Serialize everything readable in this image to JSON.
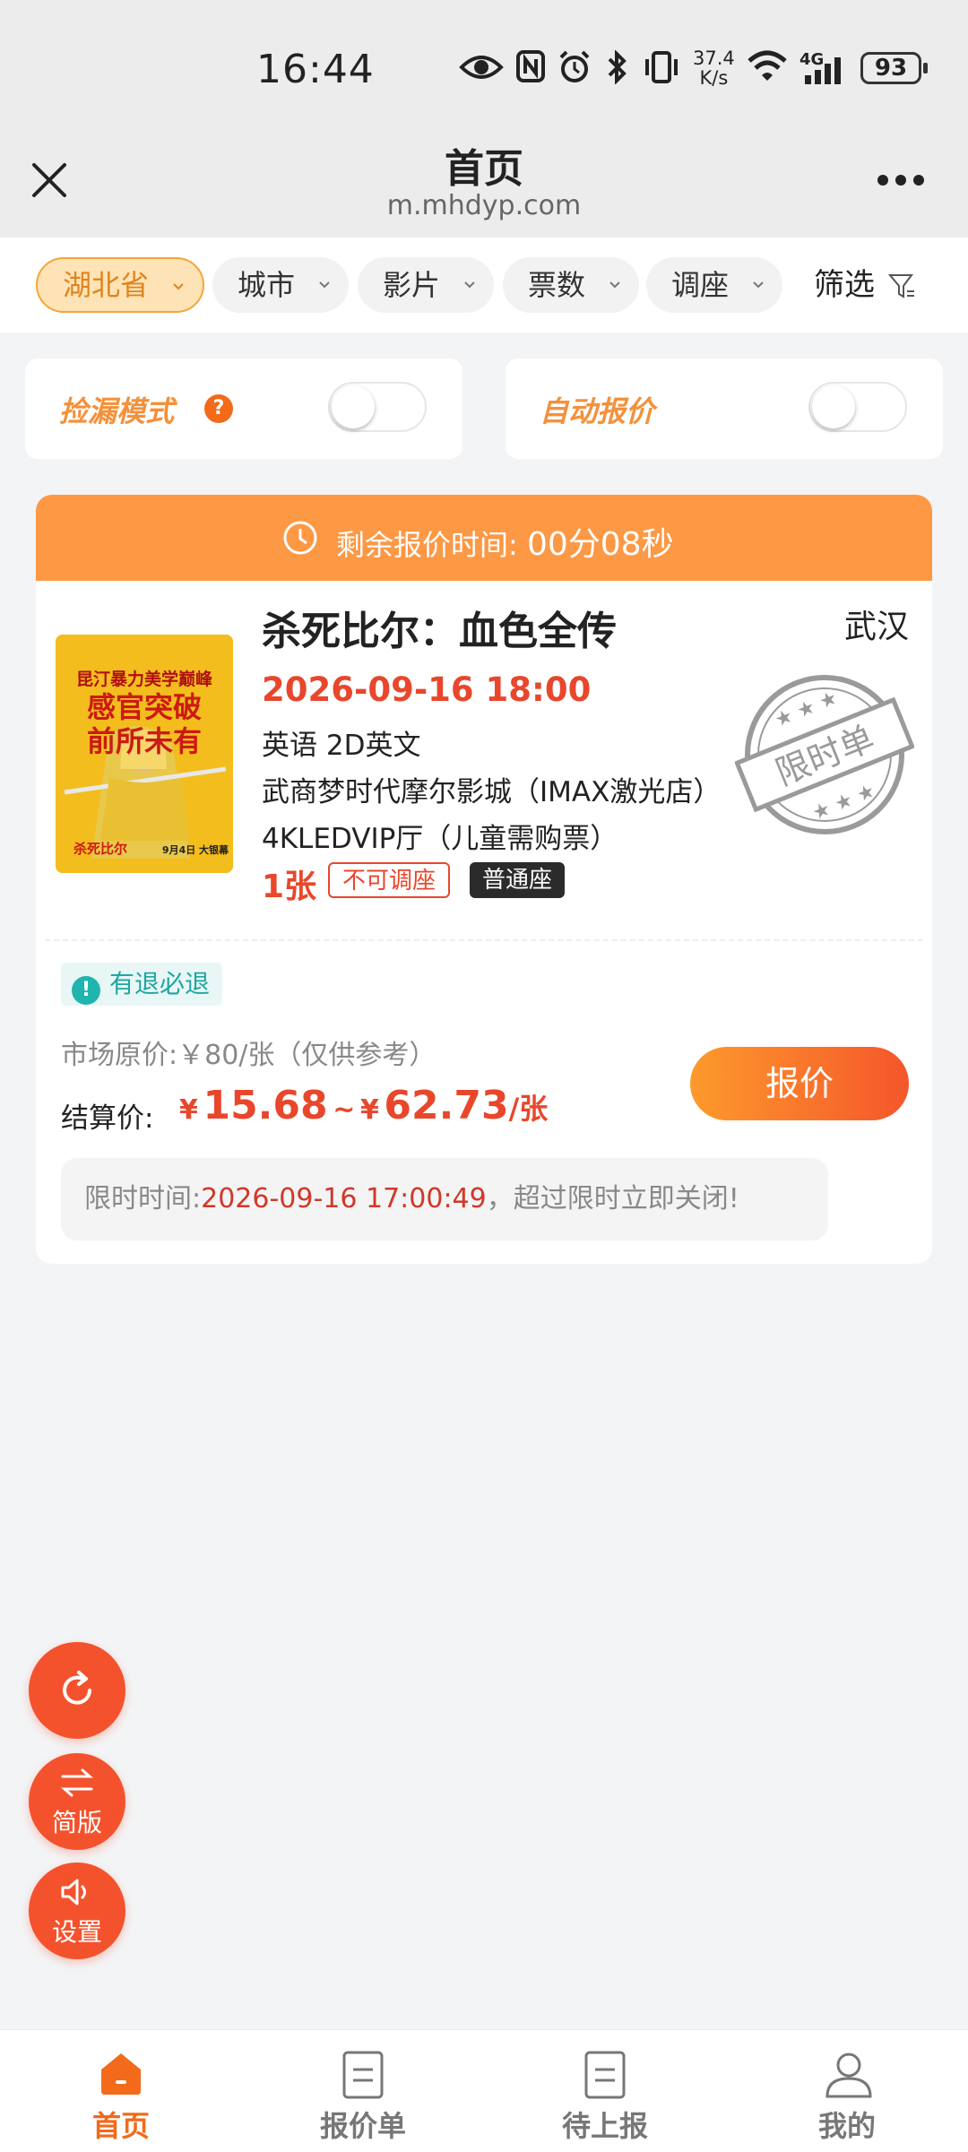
{
  "status_bar": {
    "time": "16:44",
    "net_speed_value": "37.4",
    "net_speed_unit": "K/s",
    "network_type": "4G",
    "battery": "93"
  },
  "titlebar": {
    "title": "首页",
    "url": "m.mhdyp.com"
  },
  "filters": {
    "chips": [
      "湖北省",
      "城市",
      "影片",
      "票数",
      "调座"
    ],
    "active_chip": "湖北省",
    "filter_label": "筛选"
  },
  "toggles": {
    "pickup_mode": "捡漏模式",
    "pickup_help": "?",
    "auto_quote": "自动报价"
  },
  "order": {
    "timer_label": "剩余报价时间:",
    "timer_value": "00分08秒",
    "poster_text_top": "昆汀暴力美学巅峰",
    "poster_text_main1": "感官突破",
    "poster_text_main2": "前所未有",
    "poster_text_title": "杀死比尔",
    "poster_text_date": "9月4日 大银幕",
    "movie_title": "杀死比尔：血色全传",
    "city": "武汉",
    "showtime": "2026-09-16 18:00",
    "language": "英语 2D英文",
    "cinema": "武商梦时代摩尔影城（IMAX激光店）",
    "hall": "4KLEDVIP厅（儿童需购票）",
    "quantity": "1张",
    "tag_no_swap": "不可调座",
    "tag_seat_type": "普通座",
    "stamp_text": "限时单",
    "refund_icon": "!",
    "refund_badge": "有退必退",
    "market_price": "市场原价:￥80/张（仅供参考）",
    "settle_label": "结算价:",
    "currency": "¥",
    "price_min": "15.68",
    "price_sep": "~",
    "price_max": "62.73",
    "price_unit": "/张",
    "quote_button": "报价",
    "deadline_label": "限时时间:",
    "deadline_time": "2026-09-16 17:00:49",
    "deadline_suffix": "，超过限时立即关闭!"
  },
  "fabs": {
    "simple_label": "简版",
    "settings_label": "设置"
  },
  "bottom_nav": {
    "items": [
      {
        "label": "首页",
        "icon": "home-icon",
        "active": true
      },
      {
        "label": "报价单",
        "icon": "document-icon",
        "active": false
      },
      {
        "label": "待上报",
        "icon": "document-icon",
        "active": false
      },
      {
        "label": "我的",
        "icon": "user-icon",
        "active": false
      }
    ]
  },
  "colors": {
    "accent_orange": "#fd9845",
    "price_red": "#e8472c",
    "fab_red": "#f4522d",
    "refund_teal": "#1fa6a2"
  }
}
